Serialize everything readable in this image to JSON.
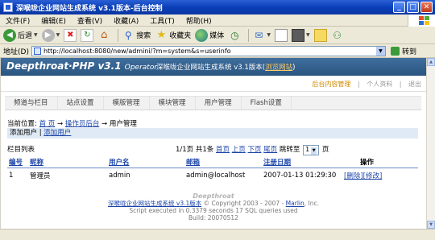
{
  "window": {
    "title": "深喉咙企业网站生成系统 v3.1版本-后台控制"
  },
  "menu": [
    "文件(F)",
    "编辑(E)",
    "查看(V)",
    "收藏(A)",
    "工具(T)",
    "帮助(H)"
  ],
  "toolbar": {
    "back_label": "后退",
    "search_label": "搜索",
    "favorites_label": "收藏夹",
    "media_label": "媒体"
  },
  "address": {
    "label": "地址(D)",
    "url": "http://localhost:8080/new/admini/?m=system&s=userinfo",
    "go_label": "转到"
  },
  "site": {
    "logo": "Deepthroat·PHP v3.1",
    "logo_sub": "Operator",
    "banner_title": "深喉咙企业网站生成系统 v3.1版本",
    "banner_link": "浏览网站",
    "top_links": [
      "后台内容管理",
      "个人资料",
      "退出"
    ]
  },
  "nav": [
    "频道与栏目",
    "站点设置",
    "模版管理",
    "模块管理",
    "用户管理",
    "Flash设置"
  ],
  "breadcrumb": {
    "prefix": "当前位置:",
    "home": "首 页",
    "sep1": "→",
    "ops": "操作员后台",
    "sep2": "→",
    "current": "用户管理"
  },
  "addbar": {
    "label": "添加用户",
    "sep": "|",
    "link": "添加用户"
  },
  "list": {
    "title": "栏目列表",
    "pager_text": "1/1页 共1条",
    "first": "首页",
    "prev": "上页",
    "next": "下页",
    "last": "尾页",
    "jump_label": "跳转至",
    "page_value": "1",
    "page_suffix": "页"
  },
  "table": {
    "headers": [
      "编号",
      "昵称",
      "用户名",
      "邮箱",
      "注册日期",
      "操作"
    ],
    "rows": [
      {
        "id": "1",
        "nickname": "管理员",
        "username": "admin",
        "email": "admin@localhost",
        "date": "2007-01-13 01:29:30",
        "action_delete": "[删除]",
        "action_edit": "[修改]"
      }
    ]
  },
  "footer": {
    "logo": "Deepthroat",
    "line1_link": "深喉咙企业网站生成系统 v3.1版本",
    "line1_text": " © Copyright 2003 - 2007 - ",
    "line1_company": "Marlin",
    "line1_end": ", Inc.",
    "line2": "Script executed in 0.3379 seconds 17 SQL queries used",
    "line3": "Build: 20070512"
  }
}
